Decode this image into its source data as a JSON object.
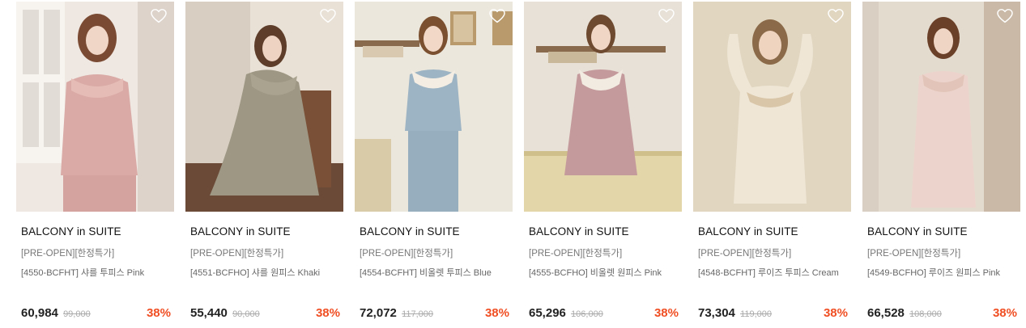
{
  "products": [
    {
      "brand": "BALCONY in SUITE",
      "tag": "[PRE-OPEN][한정특가]",
      "name": "[4550-BCFHT] 샤를 투피스 Pink",
      "price": "60,984",
      "original_price": "99,000",
      "discount": "38%",
      "colors": {
        "bg": "#efe7e1",
        "dress": "#d9aaa6"
      }
    },
    {
      "brand": "BALCONY in SUITE",
      "tag": "[PRE-OPEN][한정특가]",
      "name": "[4551-BCFHO] 샤를 원피스 Khaki",
      "price": "55,440",
      "original_price": "90,000",
      "discount": "38%",
      "colors": {
        "bg": "#e9e1d6",
        "dress": "#9e9784"
      }
    },
    {
      "brand": "BALCONY in SUITE",
      "tag": "[PRE-OPEN][한정특가]",
      "name": "[4554-BCFHT] 비올렛 투피스 Blue",
      "price": "72,072",
      "original_price": "117,000",
      "discount": "38%",
      "colors": {
        "bg": "#ece7dc",
        "dress": "#9db4c4"
      }
    },
    {
      "brand": "BALCONY in SUITE",
      "tag": "[PRE-OPEN][한정특가]",
      "name": "[4555-BCFHO] 비올렛 원피스 Pink",
      "price": "65,296",
      "original_price": "106,000",
      "discount": "38%",
      "colors": {
        "bg": "#ebe5dc",
        "dress": "#c59a9c"
      }
    },
    {
      "brand": "BALCONY in SUITE",
      "tag": "[PRE-OPEN][한정특가]",
      "name": "[4548-BCFHT] 루이즈 투피스 Cream",
      "price": "73,304",
      "original_price": "119,000",
      "discount": "38%",
      "colors": {
        "bg": "#e6dcc9",
        "dress": "#efe6d6"
      }
    },
    {
      "brand": "BALCONY in SUITE",
      "tag": "[PRE-OPEN][한정특가]",
      "name": "[4549-BCFHO] 루이즈 원피스 Pink",
      "price": "66,528",
      "original_price": "108,000",
      "discount": "38%",
      "colors": {
        "bg": "#e4dbcf",
        "dress": "#ecd4cc"
      }
    }
  ]
}
